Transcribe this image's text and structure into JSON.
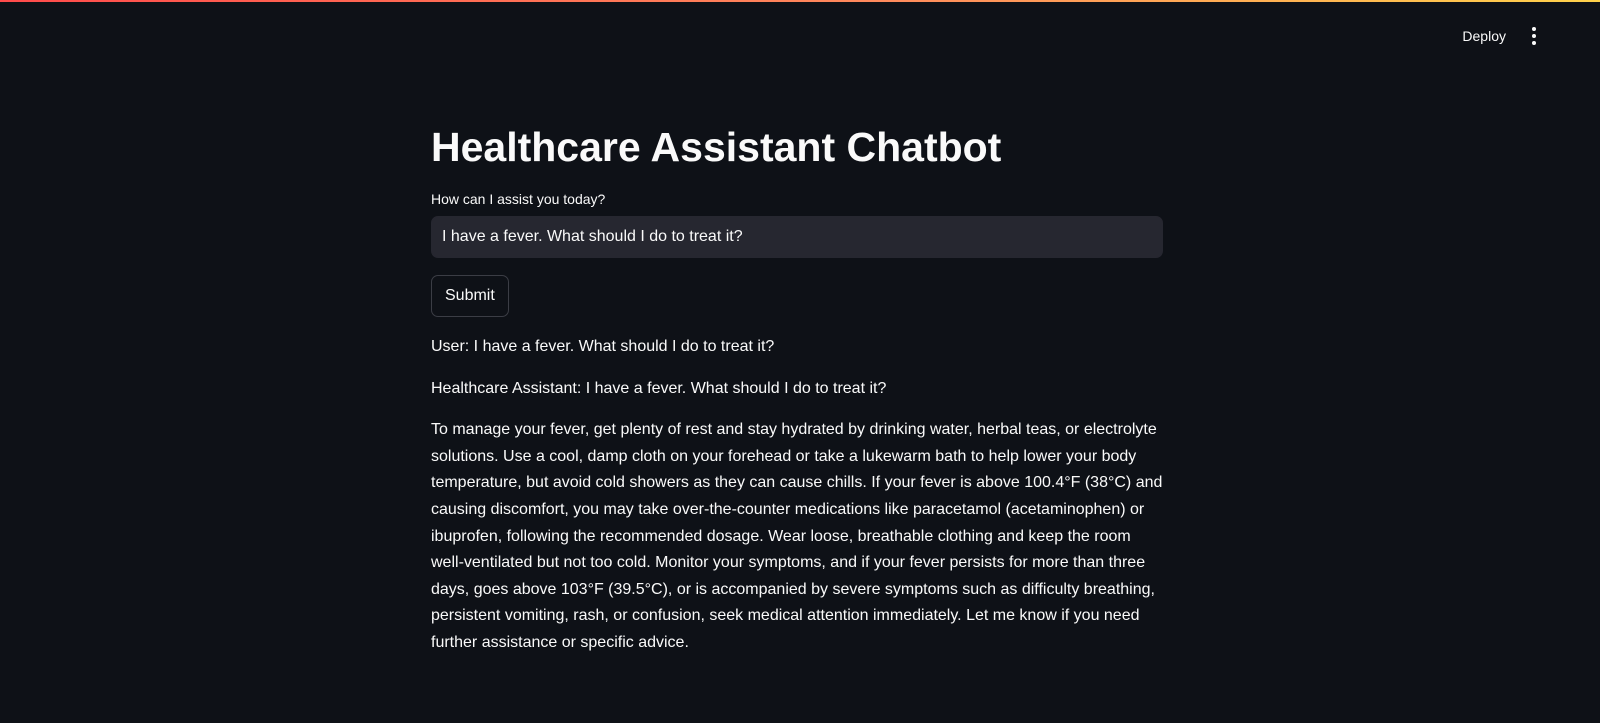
{
  "header": {
    "deploy_label": "Deploy",
    "menu_icon": "vertical-ellipsis-icon"
  },
  "main": {
    "title": "Healthcare Assistant Chatbot",
    "input_label": "How can I assist you today?",
    "input_value": "I have a fever. What should I do to treat it?",
    "submit_label": "Submit"
  },
  "conversation": {
    "user_message": "User: I have a fever. What should I do to treat it?",
    "assistant_message": "Healthcare Assistant: I have a fever. What should I do to treat it?",
    "response": "To manage your fever, get plenty of rest and stay hydrated by drinking water, herbal teas, or electrolyte solutions. Use a cool, damp cloth on your forehead or take a lukewarm bath to help lower your body temperature, but avoid cold showers as they can cause chills. If your fever is above 100.4°F (38°C) and causing discomfort, you may take over-the-counter medications like paracetamol (acetaminophen) or ibuprofen, following the recommended dosage. Wear loose, breathable clothing and keep the room well-ventilated but not too cold. Monitor your symptoms, and if your fever persists for more than three days, goes above 103°F (39.5°C), or is accompanied by severe symptoms such as difficulty breathing, persistent vomiting, rash, or confusion, seek medical attention immediately. Let me know if you need further assistance or specific advice."
  },
  "colors": {
    "background": "#0e1117",
    "input_background": "#262730",
    "text": "#fafafa",
    "accent_gradient_start": "#ff4b4b",
    "accent_gradient_end": "#ffd24b"
  }
}
